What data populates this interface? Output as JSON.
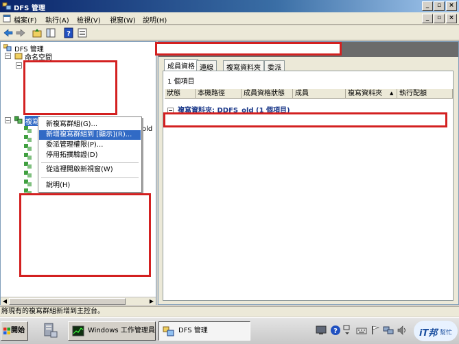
{
  "window": {
    "title": "DFS 管理",
    "minimize": "_",
    "restore": "▫",
    "close": "×"
  },
  "menubar": {
    "items": [
      {
        "label": "檔案(F)"
      },
      {
        "label": "執行(A)"
      },
      {
        "label": "檢視(V)"
      },
      {
        "label": "視窗(W)"
      },
      {
        "label": "說明(H)"
      }
    ]
  },
  "tree": {
    "root": "DFS 管理",
    "namespaces": "命名空間",
    "replication": "複寫",
    "partial_text": "old"
  },
  "context_menu": {
    "items": [
      {
        "label": "新複寫群組(G)..."
      },
      {
        "label": "新增複寫群組到 [顯示](R)..."
      },
      {
        "label": "委派管理權限(P)..."
      },
      {
        "label": "停用拓撲驗證(D)"
      },
      {
        "label": "從這裡開啟新視窗(W)"
      },
      {
        "label": "說明(H)"
      }
    ],
    "selected_index": 1
  },
  "right_pane": {
    "tabs": [
      {
        "label": "成員資格"
      },
      {
        "label": "連線"
      },
      {
        "label": "複寫資料夾"
      },
      {
        "label": "委派"
      }
    ],
    "active_tab": 0,
    "item_count": "1 個項目",
    "columns": [
      {
        "label": "狀態"
      },
      {
        "label": "本機路徑"
      },
      {
        "label": "成員資格狀態"
      },
      {
        "label": "成員"
      },
      {
        "label": "複寫資料夾"
      },
      {
        "label": "執行配額"
      }
    ],
    "group_row": "複寫資料夾: DDFS_old (1 個項目)"
  },
  "status_bar": {
    "text": "將現有的複寫群組新增到主控台。"
  },
  "taskbar": {
    "start_label": "開始",
    "tasks": [
      {
        "label": "Windows 工作管理員"
      },
      {
        "label": "DFS 管理"
      }
    ],
    "brand_main": "iT邦",
    "brand_sub": "幫忙"
  },
  "colors": {
    "title_bar": "#0a246a",
    "selection": "#316ac5",
    "redaction": "#d32020"
  }
}
